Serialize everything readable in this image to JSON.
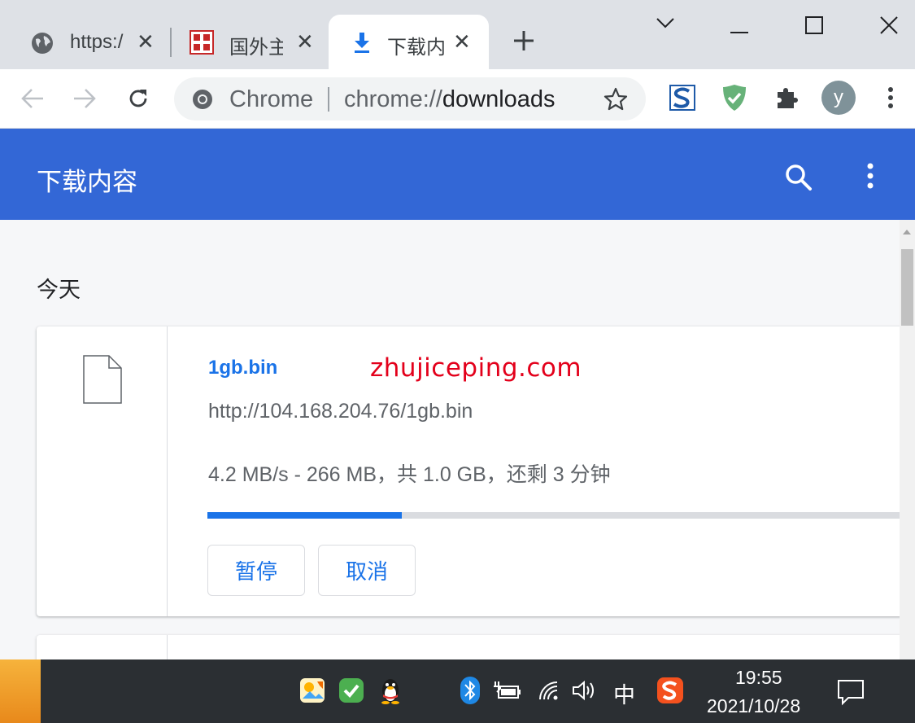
{
  "tabs": [
    {
      "title": "https:/",
      "icon": "globe-icon",
      "active": false
    },
    {
      "title": "国外主",
      "icon": "site-favicon-icon",
      "active": false
    },
    {
      "title": "下载内",
      "icon": "download-icon",
      "active": true
    }
  ],
  "toolbar": {
    "omnibox_scheme_label": "Chrome",
    "omnibox_url_prefix": "chrome://",
    "omnibox_url_host": "downloads",
    "profile_initial": "y"
  },
  "header": {
    "title": "下载内容"
  },
  "downloads": {
    "date_label": "今天",
    "item": {
      "file_name": "1gb.bin",
      "watermark": "zhujiceping.com",
      "url": "http://104.168.204.76/1gb.bin",
      "status": "4.2 MB/s - 266 MB，共 1.0 GB，还剩 3 分钟",
      "progress_fraction": 0.266,
      "pause_label": "暂停",
      "cancel_label": "取消"
    }
  },
  "taskbar": {
    "ime_label": "中",
    "time": "19:55",
    "date": "2021/10/28"
  },
  "colors": {
    "header_bg": "#3367d6",
    "accent_blue": "#1a73e8",
    "watermark_red": "#e3001b",
    "taskbar_bg": "#2b2f33"
  }
}
